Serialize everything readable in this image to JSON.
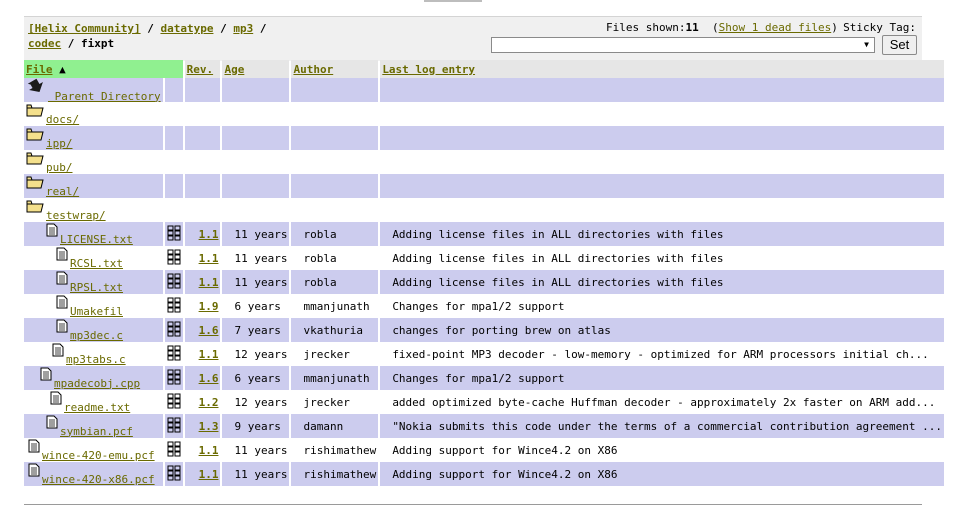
{
  "breadcrumb": {
    "items": [
      "[Helix Community]",
      "datatype",
      "mp3",
      "codec"
    ],
    "current": "fixpt",
    "separator": "/"
  },
  "files_shown": {
    "label": "Files shown:",
    "count": "11",
    "dead_link": "Show 1 dead files"
  },
  "sticky_tag": {
    "label": "Sticky Tag:",
    "value": "",
    "button": "Set"
  },
  "table": {
    "columns": {
      "file": "File",
      "rev": "Rev.",
      "age": "Age",
      "author": "Author",
      "log": "Last log entry"
    },
    "rows": [
      {
        "type": "parent",
        "name": "Parent Directory",
        "indent": 0
      },
      {
        "type": "dir",
        "name": "docs/",
        "indent": 0
      },
      {
        "type": "dir",
        "name": "ipp/",
        "indent": 0
      },
      {
        "type": "dir",
        "name": "pub/",
        "indent": 0
      },
      {
        "type": "dir",
        "name": "real/",
        "indent": 0
      },
      {
        "type": "dir",
        "name": "testwrap/",
        "indent": 0
      },
      {
        "type": "file",
        "name": "LICENSE.txt",
        "indent": 20,
        "rev": "1.1",
        "age": "11 years",
        "author": "robla",
        "log": "Adding license files in ALL directories with files"
      },
      {
        "type": "file",
        "name": "RCSL.txt",
        "indent": 30,
        "rev": "1.1",
        "age": "11 years",
        "author": "robla",
        "log": "Adding license files in ALL directories with files"
      },
      {
        "type": "file",
        "name": "RPSL.txt",
        "indent": 30,
        "rev": "1.1",
        "age": "11 years",
        "author": "robla",
        "log": "Adding license files in ALL directories with files"
      },
      {
        "type": "file",
        "name": "Umakefil",
        "indent": 30,
        "rev": "1.9",
        "age": "6 years",
        "author": "mmanjunath",
        "log": "Changes for mpa1/2 support"
      },
      {
        "type": "file",
        "name": "mp3dec.c",
        "indent": 30,
        "rev": "1.6",
        "age": "7 years",
        "author": "vkathuria",
        "log": "changes for porting brew on atlas"
      },
      {
        "type": "file",
        "name": "mp3tabs.c",
        "indent": 26,
        "rev": "1.1",
        "age": "12 years",
        "author": "jrecker",
        "log": "fixed-point MP3 decoder - low-memory - optimized for ARM processors initial ch..."
      },
      {
        "type": "file",
        "name": "mpadecobj.cpp",
        "indent": 14,
        "rev": "1.6",
        "age": "6 years",
        "author": "mmanjunath",
        "log": "Changes for mpa1/2 support"
      },
      {
        "type": "file",
        "name": "readme.txt",
        "indent": 24,
        "rev": "1.2",
        "age": "12 years",
        "author": "jrecker",
        "log": "added optimized byte-cache Huffman decoder - approximately 2x faster on ARM add..."
      },
      {
        "type": "file",
        "name": "symbian.pcf",
        "indent": 20,
        "rev": "1.3",
        "age": "9 years",
        "author": "damann",
        "log": "\"Nokia submits this code under the terms of a commercial contribution agreement ..."
      },
      {
        "type": "file",
        "name": "wince-420-emu.pcf",
        "indent": 2,
        "rev": "1.1",
        "age": "11 years",
        "author": "rishimathew",
        "log": "Adding support for Wince4.2 on X86"
      },
      {
        "type": "file",
        "name": "wince-420-x86.pcf",
        "indent": 2,
        "rev": "1.1",
        "age": "11 years",
        "author": "rishimathew",
        "log": "Adding support for Wince4.2 on X86"
      }
    ]
  }
}
